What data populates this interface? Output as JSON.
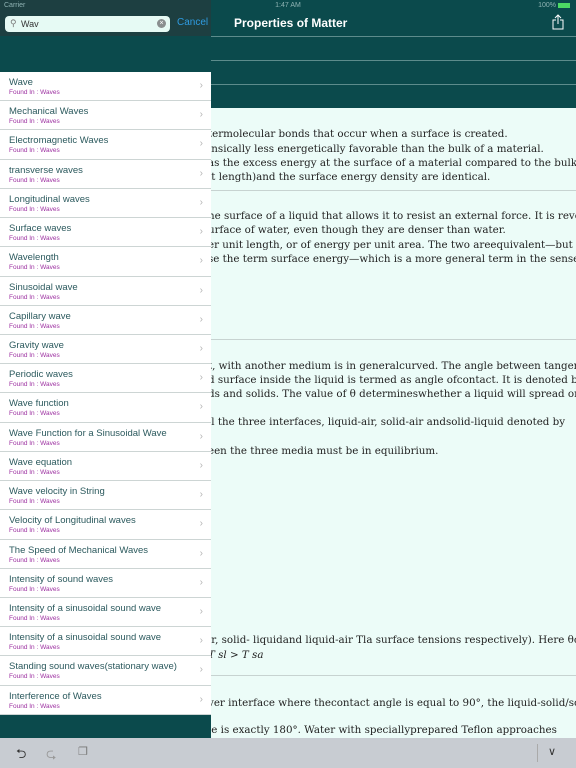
{
  "status": {
    "carrier": "Carrier",
    "time": "1:47 AM",
    "battery": "100%"
  },
  "header": {
    "title": "Properties of Matter",
    "share_icon": "share-icon"
  },
  "search": {
    "value": "Wav",
    "cancel": "Cancel"
  },
  "results": [
    {
      "title": "Wave",
      "found": "Found In : Waves"
    },
    {
      "title": "Mechanical Waves",
      "found": "Found In : Waves"
    },
    {
      "title": "Electromagnetic Waves",
      "found": "Found In : Waves"
    },
    {
      "title": "transverse waves",
      "found": "Found In : Waves"
    },
    {
      "title": "Longitudinal waves",
      "found": "Found In : Waves"
    },
    {
      "title": "Surface waves",
      "found": "Found In : Waves"
    },
    {
      "title": "Wavelength",
      "found": "Found In : Waves"
    },
    {
      "title": "Sinusoidal wave",
      "found": "Found In : Waves"
    },
    {
      "title": "Capillary wave",
      "found": "Found In : Waves"
    },
    {
      "title": "Gravity wave",
      "found": "Found In : Waves"
    },
    {
      "title": "Periodic waves",
      "found": "Found In : Waves"
    },
    {
      "title": "Wave function",
      "found": "Found In : Waves"
    },
    {
      "title": "Wave Function for a Sinusoidal Wave",
      "found": "Found In : Waves"
    },
    {
      "title": "Wave equation",
      "found": "Found In : Waves"
    },
    {
      "title": "Wave velocity in String",
      "found": "Found In : Waves"
    },
    {
      "title": "Velocity of Longitudinal waves",
      "found": "Found In : Waves"
    },
    {
      "title": "The Speed of Mechanical Waves",
      "found": "Found In : Waves"
    },
    {
      "title": "Intensity of sound waves",
      "found": "Found In : Waves"
    },
    {
      "title": "Intensity of a sinusoidal sound wave",
      "found": "Found In : Waves"
    },
    {
      "title": "Intensity of a sinusoidal sound wave",
      "found": "Found In : Waves"
    },
    {
      "title": "Standing sound waves(stationary wave)",
      "found": "Found In : Waves"
    },
    {
      "title": "Interference of Waves",
      "found": "Found In : Waves"
    }
  ],
  "content": {
    "lines": [
      "termolecular bonds that occur when a surface is created.",
      "insically less energetically favorable than the bulk of a material.",
      " as the excess energy at the surface of a material compared to the bulk.",
      "it length)and the surface energy density are identical.",
      "he surface of a liquid that allows it to resist an external force. It is revealed, for",
      "urface of water, even though they are denser than water.",
      "er unit length, or of energy per unit area. The two areequivalent—but when",
      "se the term surface energy—which is a more general term in the sense that it",
      "t, with another medium is in generalcurved. The angle between tangent to the",
      "d surface inside the liquid is termed as angle ofcontact. It is denoted by θ. It is",
      "ds and solids. The value of θ determineswhether a liquid will spread on the",
      ".",
      "ll the three interfaces, liquid-air, solid-air andsolid-liquid denoted by",
      "een the three media must be in equilibrium.",
      "ir, solid- liquidand liquid-air Tla surface tensions respectively). Here θc",
      "T sl > T sa",
      "ver interface where thecontact angle is equal to 90°, the liquid-solid/solid-air",
      "le is exactly 180°. Water with speciallyprepared Teflon approaches"
    ]
  },
  "keyboard": {
    "undo": "undo-icon",
    "redo": "redo-icon",
    "paste": "paste-icon",
    "dismiss": "chevron-down-icon"
  }
}
